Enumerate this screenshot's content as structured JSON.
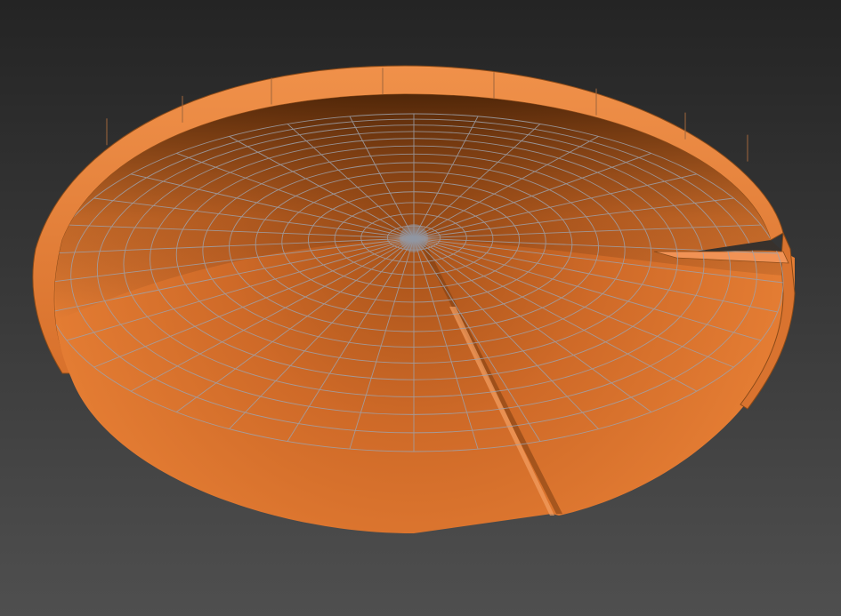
{
  "viewport": {
    "background_top": "#242424",
    "background_bottom": "#4f4f4f"
  },
  "model": {
    "name": "wireframe-dish",
    "shading": "orange",
    "colors": {
      "rim_light": "#f0914a",
      "rim_mid": "#e4782f",
      "rim_dark": "#b95a1e",
      "floor_dark": "#6a3408",
      "floor_mid": "#b4591c",
      "floor_light": "#e27b35",
      "wire": "#9ea2ab"
    }
  }
}
